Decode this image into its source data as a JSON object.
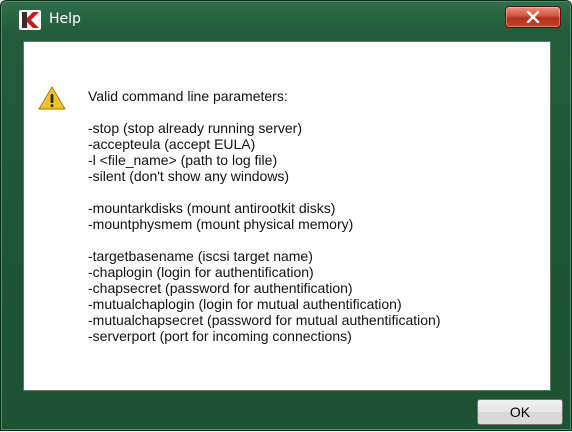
{
  "window": {
    "title": "Help",
    "close_glyph": "x",
    "icon": "kaspersky-k-icon"
  },
  "message": {
    "icon": "warning-icon",
    "heading": "Valid command line parameters:",
    "groups": [
      [
        "-stop (stop already running server)",
        "-accepteula (accept EULA)",
        "-l <file_name> (path to log file)",
        "-silent (don't show any windows)"
      ],
      [
        "-mountarkdisks (mount antirootkit disks)",
        "-mountphysmem (mount physical memory)"
      ],
      [
        "-targetbasename (iscsi target name)",
        "-chaplogin (login for authentification)",
        "-chapsecret (password for authentification)",
        "-mutualchaplogin (login for mutual authentification)",
        "-mutualchapsecret (password for mutual authentification)",
        "-serverport (port for incoming connections)"
      ]
    ]
  },
  "footer": {
    "ok_label": "OK"
  },
  "colors": {
    "frame": "#225a3b",
    "close_button": "#c9432a",
    "warning": "#f2c12e"
  }
}
